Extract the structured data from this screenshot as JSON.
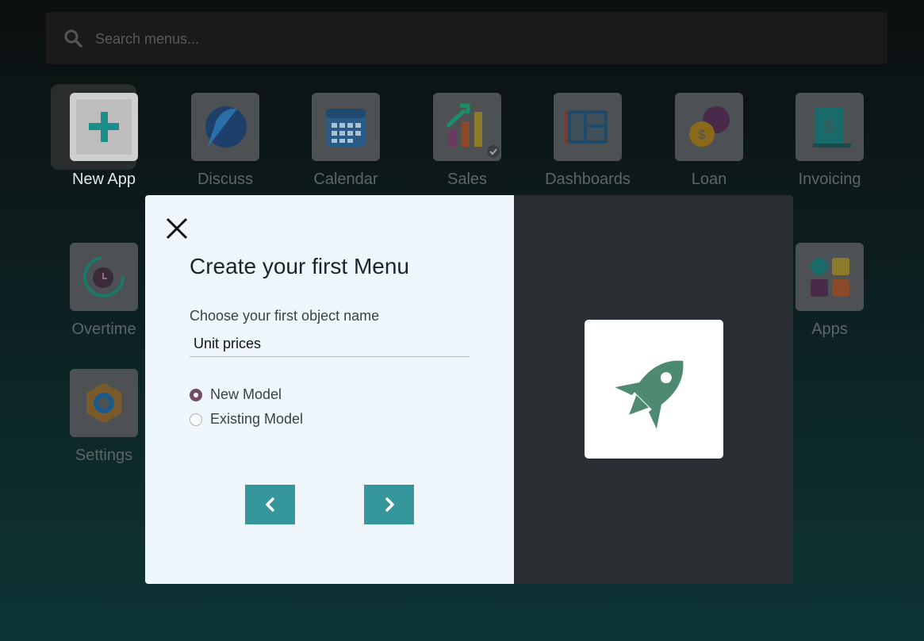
{
  "search": {
    "placeholder": "Search menus..."
  },
  "apps": [
    {
      "label": "New App",
      "icon": "plus-icon"
    },
    {
      "label": "Discuss",
      "icon": "discuss-icon"
    },
    {
      "label": "Calendar",
      "icon": "calendar-icon"
    },
    {
      "label": "Sales",
      "icon": "sales-chart-icon"
    },
    {
      "label": "Dashboards",
      "icon": "dashboard-icon"
    },
    {
      "label": "Loan",
      "icon": "loan-icon"
    },
    {
      "label": "Invoicing",
      "icon": "invoice-icon"
    },
    {
      "label": "Overtime",
      "icon": "clock-icon"
    },
    {
      "label": "Apps",
      "icon": "apps-grid-icon"
    },
    {
      "label": "Settings",
      "icon": "settings-icon"
    }
  ],
  "modal": {
    "title": "Create your first Menu",
    "field_label": "Choose your first object name",
    "object_name": "Unit prices",
    "options": [
      {
        "label": "New Model",
        "checked": true
      },
      {
        "label": "Existing Model",
        "checked": false
      }
    ],
    "illustration": "rocket-icon"
  },
  "colors": {
    "accent": "#35979c",
    "radio_checked": "#714b67",
    "rocket": "#4e8a72",
    "modal_left_bg": "#eff7fd",
    "modal_right_bg": "#2b2e33"
  }
}
